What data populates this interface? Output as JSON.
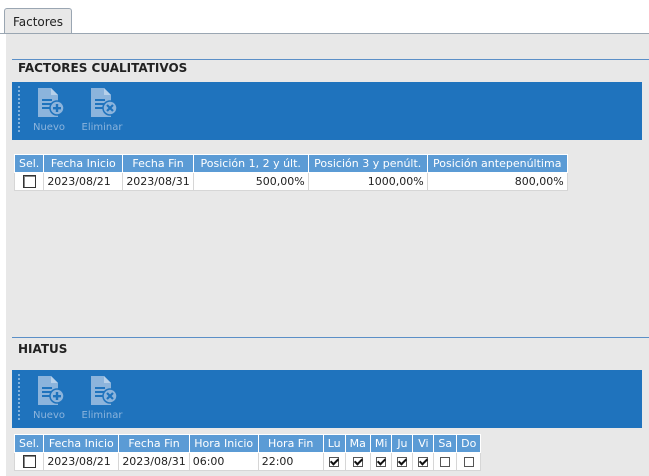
{
  "tab": {
    "label": "Factores"
  },
  "cualitativos": {
    "title": "FACTORES CUALITATIVOS",
    "toolbar": {
      "nuevo": "Nuevo",
      "eliminar": "Eliminar"
    },
    "columns": [
      "Sel.",
      "Fecha Inicio",
      "Fecha Fin",
      "Posición 1, 2 y últ.",
      "Posición 3 y penúlt.",
      "Posición antepenúltima"
    ],
    "rows": [
      {
        "fecha_inicio": "2023/08/21",
        "fecha_fin": "2023/08/31",
        "pos12": "500,00%",
        "pos3": "1000,00%",
        "antepen": "800,00%"
      }
    ]
  },
  "hiatus": {
    "title": "HIATUS",
    "toolbar": {
      "nuevo": "Nuevo",
      "eliminar": "Eliminar"
    },
    "columns": [
      "Sel.",
      "Fecha Inicio",
      "Fecha Fin",
      "Hora Inicio",
      "Hora Fin",
      "Lu",
      "Ma",
      "Mi",
      "Ju",
      "Vi",
      "Sa",
      "Do"
    ],
    "rows": [
      {
        "fecha_inicio": "2023/08/21",
        "fecha_fin": "2023/08/31",
        "hora_inicio": "06:00",
        "hora_fin": "22:00",
        "days": [
          true,
          true,
          true,
          true,
          true,
          false,
          false
        ]
      }
    ]
  },
  "colors": {
    "toolbar": "#1f73bd",
    "header": "#5b9bd5",
    "panel": "#e8e8e8",
    "rule": "#5b8fc7"
  },
  "icons": {
    "new": "document-add-icon",
    "delete": "document-delete-icon"
  }
}
